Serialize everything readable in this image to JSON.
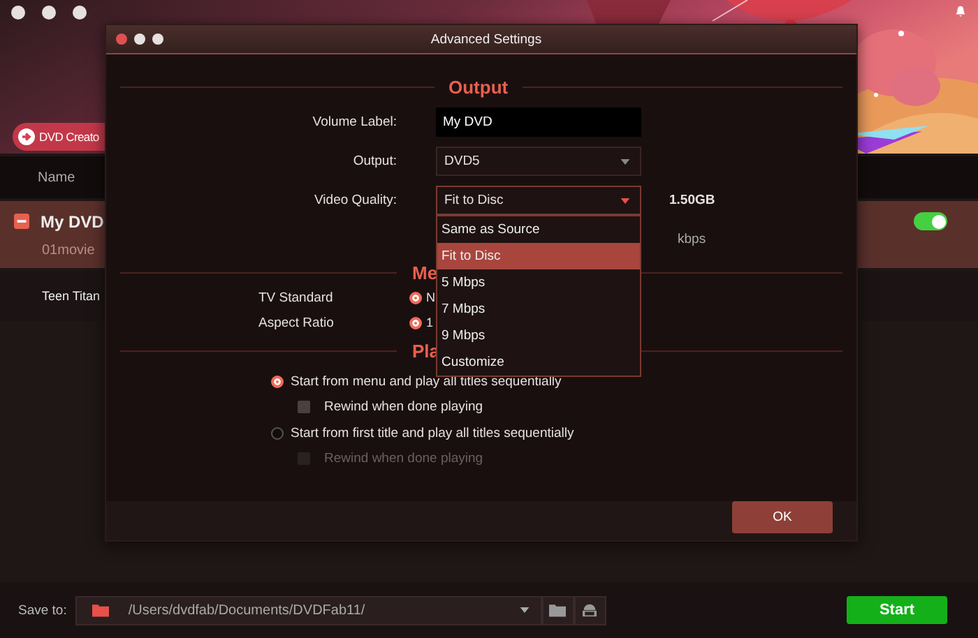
{
  "app": {
    "creator_button": "DVD Creato",
    "column_header": "Name",
    "titles": [
      {
        "name": "My DVD",
        "subtitle": "01movie",
        "selected": true,
        "on": true
      },
      {
        "name": "Teen Titan",
        "selected": false
      }
    ]
  },
  "footer": {
    "save_label": "Save to:",
    "path": "/Users/dvdfab/Documents/DVDFab11/",
    "start_button": "Start"
  },
  "dialog": {
    "title": "Advanced Settings",
    "output_section": {
      "heading": "Output",
      "volume_label": {
        "label": "Volume Label:",
        "value": "My DVD"
      },
      "output": {
        "label": "Output:",
        "value": "DVD5"
      },
      "video_quality": {
        "label": "Video Quality:",
        "value": "Fit to Disc",
        "size": "1.50GB",
        "options": [
          {
            "label": "Same as Source",
            "selected": false
          },
          {
            "label": "Fit to Disc",
            "selected": true
          },
          {
            "label": "5 Mbps",
            "selected": false
          },
          {
            "label": "7 Mbps",
            "selected": false
          },
          {
            "label": "9 Mbps",
            "selected": false
          },
          {
            "label": "Customize",
            "selected": false
          }
        ]
      },
      "bitrate_unit": "kbps"
    },
    "menu_section": {
      "heading": "Me",
      "rows": [
        {
          "label": "TV Standard",
          "option": "N",
          "selected": true
        },
        {
          "label": "Aspect Ratio",
          "option": "1",
          "selected": true
        }
      ]
    },
    "playback_section": {
      "heading": "Pla",
      "options": [
        {
          "kind": "radio",
          "label": "Start from menu and play all titles sequentially",
          "selected": true
        },
        {
          "kind": "checkbox",
          "label": "Rewind when done playing",
          "checked": false,
          "disabled": false
        },
        {
          "kind": "radio",
          "label": "Start from first title and play all titles sequentially",
          "selected": false
        },
        {
          "kind": "checkbox",
          "label": "Rewind when done playing",
          "checked": false,
          "disabled": true
        }
      ]
    },
    "ok_button": "OK"
  }
}
